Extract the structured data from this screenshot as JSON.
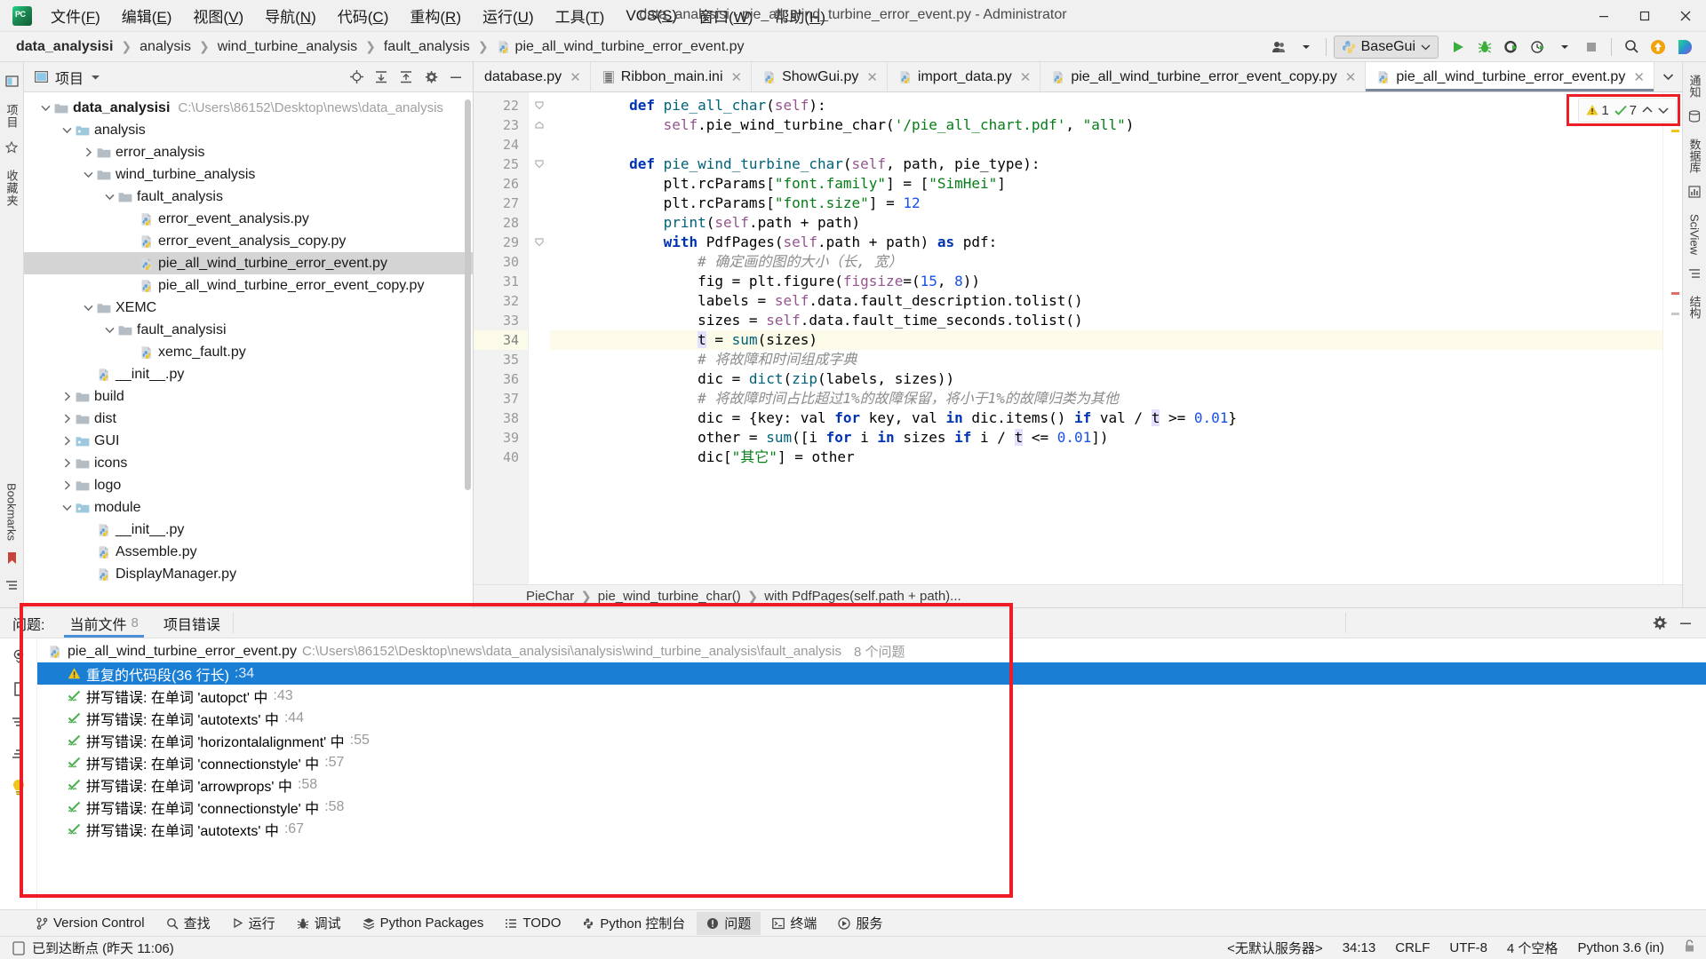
{
  "window": {
    "title": "data_analysisi - pie_all_wind_turbine_error_event.py - Administrator",
    "minimize": "–",
    "maximize": "□",
    "close": "✕"
  },
  "menu": [
    {
      "label": "文件(F)"
    },
    {
      "label": "编辑(E)"
    },
    {
      "label": "视图(V)"
    },
    {
      "label": "导航(N)"
    },
    {
      "label": "代码(C)"
    },
    {
      "label": "重构(R)"
    },
    {
      "label": "运行(U)"
    },
    {
      "label": "工具(T)"
    },
    {
      "label": "VCS(S)"
    },
    {
      "label": "窗口(W)"
    },
    {
      "label": "帮助(H)"
    }
  ],
  "breadcrumbs": [
    {
      "label": "data_analysisi",
      "bold": true
    },
    {
      "label": "analysis",
      "bold": false
    },
    {
      "label": "wind_turbine_analysis",
      "bold": false
    },
    {
      "label": "fault_analysis",
      "bold": false
    },
    {
      "label": "pie_all_wind_turbine_error_event.py",
      "bold": false,
      "icon": "python-file-icon"
    }
  ],
  "toolbar": {
    "run_config": "BaseGui",
    "buttons": [
      {
        "name": "run-button",
        "label": "运行"
      },
      {
        "name": "debug-button",
        "label": "调试"
      },
      {
        "name": "run-coverage-button",
        "label": "运行并覆盖"
      },
      {
        "name": "profile-button",
        "label": "性能分析"
      },
      {
        "name": "stop-button",
        "label": "停止"
      },
      {
        "name": "search-everywhere-button",
        "label": "搜索"
      },
      {
        "name": "update-project-button",
        "label": "更新项目"
      },
      {
        "name": "ide-assistant-button",
        "label": "助手"
      }
    ]
  },
  "project_panel": {
    "title": "项目",
    "header_icons": [
      "locate-icon",
      "expand-all-icon",
      "collapse-all-icon",
      "settings-icon",
      "hide-icon"
    ],
    "tree": [
      {
        "indent": 0,
        "twist": "down",
        "icon": "folder",
        "name": "data_analysisi",
        "bold": true,
        "path": "C:\\Users\\86152\\Desktop\\news\\data_analysis",
        "selected": false
      },
      {
        "indent": 1,
        "twist": "down",
        "icon": "folder-src",
        "name": "analysis",
        "bold": false,
        "path": "",
        "selected": false
      },
      {
        "indent": 2,
        "twist": "right",
        "icon": "folder",
        "name": "error_analysis",
        "bold": false,
        "path": "",
        "selected": false
      },
      {
        "indent": 2,
        "twist": "down",
        "icon": "folder",
        "name": "wind_turbine_analysis",
        "bold": false,
        "path": "",
        "selected": false
      },
      {
        "indent": 3,
        "twist": "down",
        "icon": "folder",
        "name": "fault_analysis",
        "bold": false,
        "path": "",
        "selected": false
      },
      {
        "indent": 4,
        "twist": "none",
        "icon": "python",
        "name": "error_event_analysis.py",
        "bold": false,
        "path": "",
        "selected": false
      },
      {
        "indent": 4,
        "twist": "none",
        "icon": "python",
        "name": "error_event_analysis_copy.py",
        "bold": false,
        "path": "",
        "selected": false
      },
      {
        "indent": 4,
        "twist": "none",
        "icon": "python",
        "name": "pie_all_wind_turbine_error_event.py",
        "bold": false,
        "path": "",
        "selected": true
      },
      {
        "indent": 4,
        "twist": "none",
        "icon": "python",
        "name": "pie_all_wind_turbine_error_event_copy.py",
        "bold": false,
        "path": "",
        "selected": false
      },
      {
        "indent": 2,
        "twist": "down",
        "icon": "folder",
        "name": "XEMC",
        "bold": false,
        "path": "",
        "selected": false
      },
      {
        "indent": 3,
        "twist": "down",
        "icon": "folder",
        "name": "fault_analysisi",
        "bold": false,
        "path": "",
        "selected": false
      },
      {
        "indent": 4,
        "twist": "none",
        "icon": "python",
        "name": "xemc_fault.py",
        "bold": false,
        "path": "",
        "selected": false
      },
      {
        "indent": 2,
        "twist": "none",
        "icon": "python",
        "name": "__init__.py",
        "bold": false,
        "path": "",
        "selected": false
      },
      {
        "indent": 1,
        "twist": "right",
        "icon": "folder",
        "name": "build",
        "bold": false,
        "path": "",
        "selected": false
      },
      {
        "indent": 1,
        "twist": "right",
        "icon": "folder",
        "name": "dist",
        "bold": false,
        "path": "",
        "selected": false
      },
      {
        "indent": 1,
        "twist": "right",
        "icon": "folder-src",
        "name": "GUI",
        "bold": false,
        "path": "",
        "selected": false
      },
      {
        "indent": 1,
        "twist": "right",
        "icon": "folder",
        "name": "icons",
        "bold": false,
        "path": "",
        "selected": false
      },
      {
        "indent": 1,
        "twist": "right",
        "icon": "folder",
        "name": "logo",
        "bold": false,
        "path": "",
        "selected": false
      },
      {
        "indent": 1,
        "twist": "down",
        "icon": "folder-src",
        "name": "module",
        "bold": false,
        "path": "",
        "selected": false
      },
      {
        "indent": 2,
        "twist": "none",
        "icon": "python",
        "name": "__init__.py",
        "bold": false,
        "path": "",
        "selected": false
      },
      {
        "indent": 2,
        "twist": "none",
        "icon": "python",
        "name": "Assemble.py",
        "bold": false,
        "path": "",
        "selected": false
      },
      {
        "indent": 2,
        "twist": "none",
        "icon": "python",
        "name": "DisplayManager.py",
        "bold": false,
        "path": "",
        "selected": false
      }
    ]
  },
  "editor": {
    "tabs": [
      {
        "label": "database.py",
        "icon": "python-file-icon",
        "active": false,
        "clipped": true
      },
      {
        "label": "Ribbon_main.ini",
        "icon": "ini-file-icon",
        "active": false,
        "clipped": false
      },
      {
        "label": "ShowGui.py",
        "icon": "python-file-icon",
        "active": false,
        "clipped": false
      },
      {
        "label": "import_data.py",
        "icon": "python-file-icon",
        "active": false,
        "clipped": false
      },
      {
        "label": "pie_all_wind_turbine_error_event_copy.py",
        "icon": "python-file-icon",
        "active": false,
        "clipped": false
      },
      {
        "label": "pie_all_wind_turbine_error_event.py",
        "icon": "python-file-icon",
        "active": true,
        "clipped": false
      }
    ],
    "inspection": {
      "warnings": "1",
      "weak_warnings": "7"
    },
    "first_line": 22,
    "current_line": 34,
    "lines": [
      {
        "n": 22,
        "fold": "start",
        "tokens": [
          {
            "t": "        ",
            "c": "op"
          },
          {
            "t": "def ",
            "c": "kw"
          },
          {
            "t": "pie_all_char",
            "c": "fn"
          },
          {
            "t": "(",
            "c": "op"
          },
          {
            "t": "self",
            "c": "self"
          },
          {
            "t": "):",
            "c": "op"
          }
        ]
      },
      {
        "n": 23,
        "fold": "end",
        "tokens": [
          {
            "t": "            ",
            "c": "op"
          },
          {
            "t": "self",
            "c": "self"
          },
          {
            "t": ".pie_wind_turbine_char(",
            "c": "op"
          },
          {
            "t": "'/pie_all_chart.pdf'",
            "c": "str"
          },
          {
            "t": ", ",
            "c": "op"
          },
          {
            "t": "\"all\"",
            "c": "str"
          },
          {
            "t": ")",
            "c": "op"
          }
        ]
      },
      {
        "n": 24,
        "fold": "none",
        "tokens": []
      },
      {
        "n": 25,
        "fold": "start",
        "tokens": [
          {
            "t": "        ",
            "c": "op"
          },
          {
            "t": "def ",
            "c": "kw"
          },
          {
            "t": "pie_wind_turbine_char",
            "c": "fn"
          },
          {
            "t": "(",
            "c": "op"
          },
          {
            "t": "self",
            "c": "self"
          },
          {
            "t": ", path, pie_type):",
            "c": "op"
          }
        ]
      },
      {
        "n": 26,
        "fold": "none",
        "tokens": [
          {
            "t": "            plt.rcParams[",
            "c": "op"
          },
          {
            "t": "\"font.family\"",
            "c": "str"
          },
          {
            "t": "] = [",
            "c": "op"
          },
          {
            "t": "\"SimHei\"",
            "c": "str"
          },
          {
            "t": "]",
            "c": "op"
          }
        ]
      },
      {
        "n": 27,
        "fold": "none",
        "tokens": [
          {
            "t": "            plt.rcParams[",
            "c": "op"
          },
          {
            "t": "\"font.size\"",
            "c": "str"
          },
          {
            "t": "] = ",
            "c": "op"
          },
          {
            "t": "12",
            "c": "num"
          }
        ]
      },
      {
        "n": 28,
        "fold": "none",
        "tokens": [
          {
            "t": "            ",
            "c": "op"
          },
          {
            "t": "print",
            "c": "fn"
          },
          {
            "t": "(",
            "c": "op"
          },
          {
            "t": "self",
            "c": "self"
          },
          {
            "t": ".path + path)",
            "c": "op"
          }
        ]
      },
      {
        "n": 29,
        "fold": "start",
        "tokens": [
          {
            "t": "            ",
            "c": "op"
          },
          {
            "t": "with ",
            "c": "kw"
          },
          {
            "t": "PdfPages(",
            "c": "op"
          },
          {
            "t": "self",
            "c": "self"
          },
          {
            "t": ".path + path) ",
            "c": "op"
          },
          {
            "t": "as ",
            "c": "kw"
          },
          {
            "t": "pdf:",
            "c": "op"
          }
        ]
      },
      {
        "n": 30,
        "fold": "none",
        "tokens": [
          {
            "t": "                # 确定画的图的大小（长, 宽）",
            "c": "cmt"
          }
        ]
      },
      {
        "n": 31,
        "fold": "none",
        "tokens": [
          {
            "t": "                fig = plt.figure(",
            "c": "op"
          },
          {
            "t": "figsize",
            "c": "self"
          },
          {
            "t": "=(",
            "c": "op"
          },
          {
            "t": "15",
            "c": "num"
          },
          {
            "t": ", ",
            "c": "op"
          },
          {
            "t": "8",
            "c": "num"
          },
          {
            "t": "))",
            "c": "op"
          }
        ]
      },
      {
        "n": 32,
        "fold": "none",
        "tokens": [
          {
            "t": "                labels = ",
            "c": "op"
          },
          {
            "t": "self",
            "c": "self"
          },
          {
            "t": ".data.fault_description.tolist()",
            "c": "op"
          }
        ]
      },
      {
        "n": 33,
        "fold": "none",
        "tokens": [
          {
            "t": "                sizes = ",
            "c": "op"
          },
          {
            "t": "self",
            "c": "self"
          },
          {
            "t": ".data.fault_time_seconds.tolist()",
            "c": "op"
          }
        ]
      },
      {
        "n": 34,
        "fold": "none",
        "cur": true,
        "tokens": [
          {
            "t": "                ",
            "c": "op"
          },
          {
            "t": "t",
            "c": "hl"
          },
          {
            "t": " = ",
            "c": "op"
          },
          {
            "t": "sum",
            "c": "fn"
          },
          {
            "t": "(sizes)",
            "c": "op"
          }
        ]
      },
      {
        "n": 35,
        "fold": "none",
        "tokens": [
          {
            "t": "                # 将故障和时间组成字典",
            "c": "cmt"
          }
        ]
      },
      {
        "n": 36,
        "fold": "none",
        "tokens": [
          {
            "t": "                dic = ",
            "c": "op"
          },
          {
            "t": "dict",
            "c": "fn"
          },
          {
            "t": "(",
            "c": "op"
          },
          {
            "t": "zip",
            "c": "fn"
          },
          {
            "t": "(labels, sizes))",
            "c": "op"
          }
        ]
      },
      {
        "n": 37,
        "fold": "none",
        "tokens": [
          {
            "t": "                # 将故障时间占比超过1%的故障保留，将小于1%的故障归类为其他",
            "c": "cmt"
          }
        ]
      },
      {
        "n": 38,
        "fold": "none",
        "tokens": [
          {
            "t": "                dic = {key: val ",
            "c": "op"
          },
          {
            "t": "for ",
            "c": "kw"
          },
          {
            "t": "key, val ",
            "c": "op"
          },
          {
            "t": "in ",
            "c": "kw"
          },
          {
            "t": "dic.items() ",
            "c": "op"
          },
          {
            "t": "if ",
            "c": "kw"
          },
          {
            "t": "val / ",
            "c": "op"
          },
          {
            "t": "t",
            "c": "hl"
          },
          {
            "t": " >= ",
            "c": "op"
          },
          {
            "t": "0.01",
            "c": "num"
          },
          {
            "t": "}",
            "c": "op"
          }
        ]
      },
      {
        "n": 39,
        "fold": "none",
        "tokens": [
          {
            "t": "                other = ",
            "c": "op"
          },
          {
            "t": "sum",
            "c": "fn"
          },
          {
            "t": "([i ",
            "c": "op"
          },
          {
            "t": "for ",
            "c": "kw"
          },
          {
            "t": "i ",
            "c": "op"
          },
          {
            "t": "in ",
            "c": "kw"
          },
          {
            "t": "sizes ",
            "c": "op"
          },
          {
            "t": "if ",
            "c": "kw"
          },
          {
            "t": "i / ",
            "c": "op"
          },
          {
            "t": "t",
            "c": "hl"
          },
          {
            "t": " <= ",
            "c": "op"
          },
          {
            "t": "0.01",
            "c": "num"
          },
          {
            "t": "])",
            "c": "op"
          }
        ]
      },
      {
        "n": 40,
        "fold": "none",
        "tokens": [
          {
            "t": "                dic[",
            "c": "op"
          },
          {
            "t": "\"其它\"",
            "c": "str"
          },
          {
            "t": "] = other",
            "c": "op"
          }
        ]
      }
    ],
    "code_breadcrumbs": [
      "PieChar",
      "pie_wind_turbine_char()",
      "with PdfPages(self.path + path)..."
    ]
  },
  "left_stripe": {
    "labels": [
      "项目",
      "收藏夹"
    ],
    "bottom_label": "Bookmarks"
  },
  "right_stripe": {
    "labels": [
      "通知",
      "数据库",
      "SciView",
      "结构"
    ]
  },
  "problems": {
    "panel_label": "问题:",
    "tabs": [
      {
        "label": "当前文件",
        "count": "8",
        "active": true
      },
      {
        "label": "项目错误",
        "count": "",
        "active": false
      }
    ],
    "file_row": {
      "name": "pie_all_wind_turbine_error_event.py",
      "path": "C:\\Users\\86152\\Desktop\\news\\data_analysisi\\analysis\\wind_turbine_analysis\\fault_analysis",
      "count": "8 个问题"
    },
    "items": [
      {
        "icon": "warning-icon",
        "text": "重复的代码段(36 行长)",
        "loc": ":34",
        "selected": true
      },
      {
        "icon": "typo-icon",
        "text": "拼写错误: 在单词 'autopct' 中",
        "loc": ":43",
        "selected": false
      },
      {
        "icon": "typo-icon",
        "text": "拼写错误: 在单词 'autotexts' 中",
        "loc": ":44",
        "selected": false
      },
      {
        "icon": "typo-icon",
        "text": "拼写错误: 在单词 'horizontalalignment' 中",
        "loc": ":55",
        "selected": false
      },
      {
        "icon": "typo-icon",
        "text": "拼写错误: 在单词 'connectionstyle' 中",
        "loc": ":57",
        "selected": false
      },
      {
        "icon": "typo-icon",
        "text": "拼写错误: 在单词 'arrowprops' 中",
        "loc": ":58",
        "selected": false
      },
      {
        "icon": "typo-icon",
        "text": "拼写错误: 在单词 'connectionstyle' 中",
        "loc": ":58",
        "selected": false
      },
      {
        "icon": "typo-icon",
        "text": "拼写错误: 在单词 'autotexts' 中",
        "loc": ":67",
        "selected": false
      }
    ]
  },
  "toolwindows": [
    {
      "label": "Version Control",
      "icon": "branch-icon",
      "active": false
    },
    {
      "label": "查找",
      "icon": "search-icon",
      "active": false
    },
    {
      "label": "运行",
      "icon": "play-icon",
      "active": false
    },
    {
      "label": "调试",
      "icon": "bug-icon",
      "active": false
    },
    {
      "label": "Python Packages",
      "icon": "packages-icon",
      "active": false
    },
    {
      "label": "TODO",
      "icon": "todo-icon",
      "active": false
    },
    {
      "label": "Python 控制台",
      "icon": "python-icon",
      "active": false
    },
    {
      "label": "问题",
      "icon": "problems-icon",
      "active": true
    },
    {
      "label": "终端",
      "icon": "terminal-icon",
      "active": false
    },
    {
      "label": "服务",
      "icon": "services-icon",
      "active": false
    }
  ],
  "statusbar": {
    "message": "已到达断点 (昨天 11:06)",
    "right": [
      {
        "name": "server-indicator",
        "label": "<无默认服务器>"
      },
      {
        "name": "caret-position",
        "label": "34:13"
      },
      {
        "name": "line-separator",
        "label": "CRLF"
      },
      {
        "name": "file-encoding",
        "label": "UTF-8"
      },
      {
        "name": "indent-setting",
        "label": "4 个空格"
      },
      {
        "name": "python-interpreter",
        "label": "Python 3.6 (in)"
      }
    ]
  }
}
